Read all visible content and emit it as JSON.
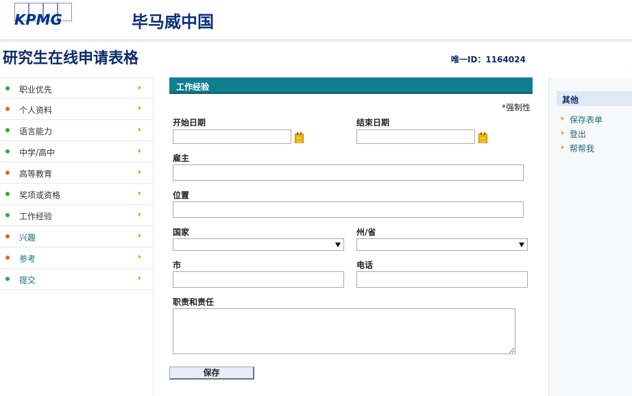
{
  "header": {
    "logo_text": "KPMG",
    "brand": "毕马威中国",
    "page_title": "研究生在线申请表格",
    "unique_id": "唯一ID：1164024"
  },
  "nav": {
    "items": [
      {
        "label": "职业优先",
        "status": "green"
      },
      {
        "label": "个人资料",
        "status": "orange"
      },
      {
        "label": "语言能力",
        "status": "green"
      },
      {
        "label": "中学/高中",
        "status": "green"
      },
      {
        "label": "高等教育",
        "status": "orange"
      },
      {
        "label": "奖项或资格",
        "status": "green"
      },
      {
        "label": "工作经验",
        "status": "green"
      },
      {
        "label": "兴趣",
        "status": "orange"
      },
      {
        "label": "参考",
        "status": "orange"
      },
      {
        "label": "提交",
        "status": "green"
      }
    ]
  },
  "form": {
    "section_title": "工作经验",
    "required_note": "*强制性",
    "fields": {
      "start_date": {
        "label": "开始日期",
        "value": ""
      },
      "end_date": {
        "label": "结束日期",
        "value": ""
      },
      "employer": {
        "label": "雇主",
        "value": ""
      },
      "position": {
        "label": "位置",
        "value": ""
      },
      "country": {
        "label": "国家",
        "value": ""
      },
      "state": {
        "label": "州/省",
        "value": ""
      },
      "city": {
        "label": "市",
        "value": ""
      },
      "phone": {
        "label": "电话",
        "value": ""
      },
      "responsibilities": {
        "label": "职责和责任",
        "value": ""
      }
    },
    "save_label": "保存"
  },
  "sidebar_right": {
    "title": "其他",
    "links": [
      "保存表单",
      "登出",
      "帮帮我"
    ]
  },
  "colors": {
    "brand_navy": "#0d2a6a",
    "section_teal": "#0f7f8f",
    "status_green": "#2fa542",
    "status_orange": "#e4642b",
    "arrow_orange": "#f0a020"
  },
  "icons": {
    "nav_status": "status-dot-icon",
    "nav_arrow": "chevron-right-icon",
    "date_picker": "calendar-icon",
    "dropdown": "caret-down-icon"
  }
}
